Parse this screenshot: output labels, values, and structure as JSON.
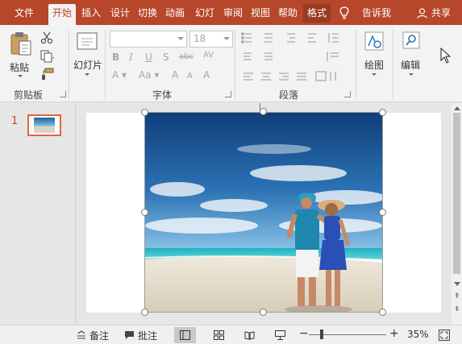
{
  "tabs": [
    {
      "label": "文件"
    },
    {
      "label": "开始"
    },
    {
      "label": "插入"
    },
    {
      "label": "设计"
    },
    {
      "label": "切换"
    },
    {
      "label": "动画"
    },
    {
      "label": "幻灯片放映"
    },
    {
      "label": "审阅"
    },
    {
      "label": "视图"
    },
    {
      "label": "帮助"
    },
    {
      "label": "格式"
    }
  ],
  "tabs_display": [
    "文件",
    "开始",
    "插入",
    "设计",
    "切换",
    "动画",
    "幻灯",
    "审阅",
    "视图",
    "帮助",
    "格式"
  ],
  "tell_me": "告诉我",
  "share": "共享",
  "clipboard": {
    "paste_label": "粘贴",
    "group_label": "剪贴板"
  },
  "slides": {
    "new_slide_label": "幻灯片"
  },
  "font": {
    "group_label": "字体",
    "size_value": "18"
  },
  "paragraph": {
    "group_label": "段落"
  },
  "drawing": {
    "label": "绘图"
  },
  "editing": {
    "label": "编辑"
  },
  "thumbnail_pane": {
    "slide_number": "1"
  },
  "statusbar": {
    "notes_label": "备注",
    "comments_label": "批注",
    "zoom_level": "35%"
  },
  "colors": {
    "accent": "#b7472a",
    "selection": "#e0643f"
  },
  "icons": [
    "lightbulb-icon",
    "user-icon",
    "paste-icon",
    "cut-icon",
    "copy-icon",
    "format-painter-icon",
    "new-slide-icon",
    "bold-icon",
    "italic-icon",
    "underline-icon",
    "strikethrough-icon",
    "bullets-icon",
    "numbering-icon",
    "align-left-icon",
    "shapes-icon",
    "search-icon",
    "cursor-icon"
  ]
}
